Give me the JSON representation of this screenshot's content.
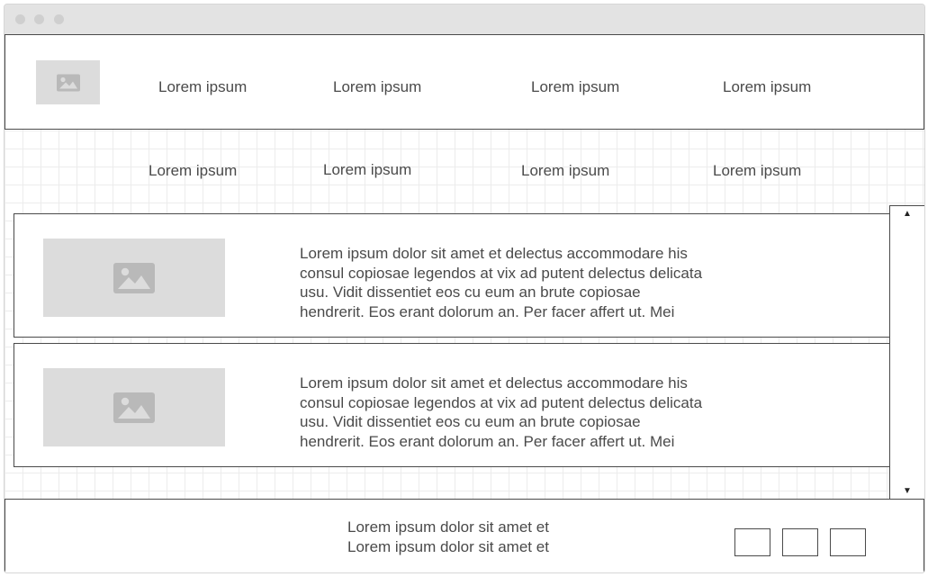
{
  "window": {
    "controls": [
      "dot",
      "dot",
      "dot"
    ]
  },
  "header": {
    "logo_icon": "image-icon",
    "nav": [
      {
        "label": "Lorem ipsum"
      },
      {
        "label": "Lorem ipsum"
      },
      {
        "label": "Lorem ipsum"
      },
      {
        "label": "Lorem ipsum"
      }
    ]
  },
  "subnav": [
    {
      "label": "Lorem ipsum"
    },
    {
      "label": "Lorem ipsum"
    },
    {
      "label": "Lorem ipsum"
    },
    {
      "label": "Lorem ipsum"
    }
  ],
  "cards": [
    {
      "image_icon": "image-icon",
      "lines": [
        "Lorem ipsum dolor sit amet et delectus accommodare his",
        "consul copiosae legendos at vix ad putent delectus delicata",
        "usu. Vidit dissentiet eos cu eum an brute copiosae",
        "hendrerit. Eos erant dolorum an. Per facer affert ut. Mei"
      ]
    },
    {
      "image_icon": "image-icon",
      "lines": [
        "Lorem ipsum dolor sit amet et delectus accommodare his",
        "consul copiosae legendos at vix ad putent delectus delicata",
        "usu. Vidit dissentiet eos cu eum an brute copiosae",
        "hendrerit. Eos erant dolorum an. Per facer affert ut. Mei"
      ]
    }
  ],
  "scrollbar": {
    "up_glyph": "▲",
    "down_glyph": "▼"
  },
  "footer": {
    "lines": [
      "Lorem ipsum dolor sit amet et",
      "Lorem ipsum dolor sit amet et"
    ],
    "buttons": [
      {
        "name": "footer-button-1"
      },
      {
        "name": "footer-button-2"
      },
      {
        "name": "footer-button-3"
      }
    ]
  },
  "colors": {
    "placeholder": "#dcdcdc",
    "placeholder_icon": "#b9b9b9",
    "border": "#4a4a4a",
    "grid": "#ececec"
  }
}
